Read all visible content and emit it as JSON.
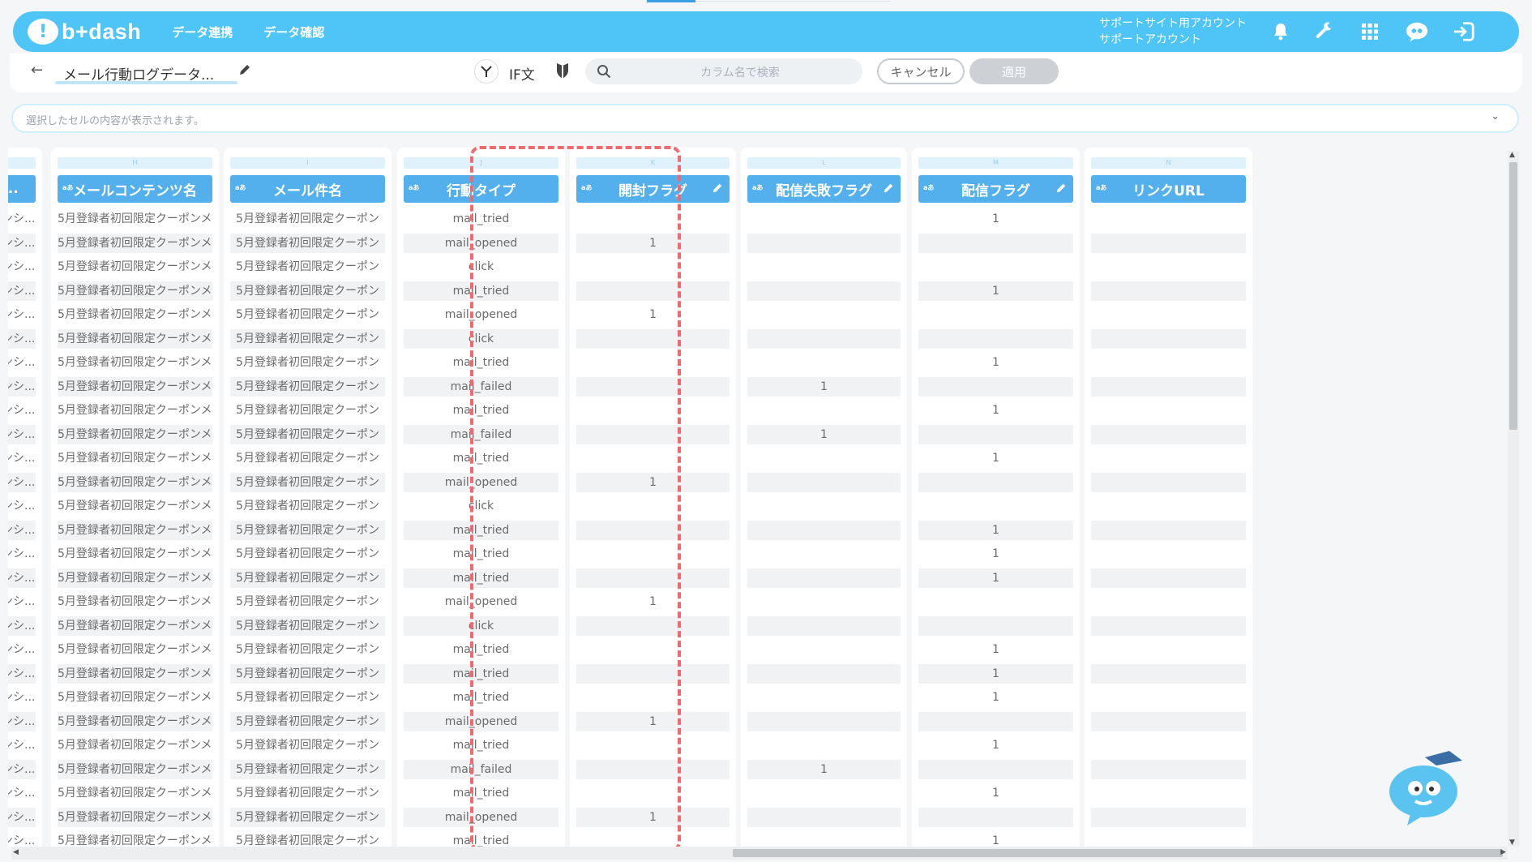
{
  "header": {
    "logo_text": "b+dash",
    "nav": [
      "データ連携",
      "データ確認"
    ],
    "account_line1": "サポートサイト用アカウント",
    "account_line2": "サポートアカウント",
    "bg_color": "#4ec4f7"
  },
  "toolbar": {
    "back_label": "←",
    "title": "メール行動ログデータ...",
    "if_label": "IF文",
    "search_placeholder": "カラム名で検索",
    "cancel_label": "キャンセル",
    "apply_label": "適用"
  },
  "cell_viewer": {
    "text": "選択したセルの内容が表示されます。"
  },
  "grid": {
    "columns": [
      {
        "letter": "",
        "name": "...",
        "type": "aあ"
      },
      {
        "letter": "H",
        "name": "メールコンテンツ名",
        "type": "aあ"
      },
      {
        "letter": "I",
        "name": "メール件名",
        "type": "aあ"
      },
      {
        "letter": "J",
        "name": "行動タイプ",
        "type": "aあ"
      },
      {
        "letter": "K",
        "name": "開封フラグ",
        "type": "aあ"
      },
      {
        "letter": "L",
        "name": "配信失敗フラグ",
        "type": "aあ"
      },
      {
        "letter": "M",
        "name": "配信フラグ",
        "type": "aあ"
      },
      {
        "letter": "N",
        "name": "リンクURL",
        "type": "aあ"
      }
    ],
    "partial_col_text": "ンシ...",
    "content_text": "5月登録者初回限定クーポンメ...",
    "subject_text": "5月登録者初回限定クーポン",
    "action_types": [
      "mail_tried",
      "mail_opened",
      "click",
      "mail_tried",
      "mail_opened",
      "click",
      "mail_tried",
      "mail_failed",
      "mail_tried",
      "mail_failed",
      "mail_tried",
      "mail_opened",
      "click",
      "mail_tried",
      "mail_tried",
      "mail_tried",
      "mail_opened",
      "click",
      "mail_tried",
      "mail_tried",
      "mail_tried",
      "mail_opened",
      "mail_tried",
      "mail_failed",
      "mail_tried",
      "mail_opened",
      "mail_tried"
    ],
    "open_flag": [
      "",
      "1",
      "",
      "",
      "1",
      "",
      "",
      "",
      "",
      "",
      "",
      "1",
      "",
      "",
      "",
      "",
      "1",
      "",
      "",
      "",
      "",
      "1",
      "",
      "",
      "",
      "1",
      ""
    ],
    "fail_flag": [
      "",
      "",
      "",
      "",
      "",
      "",
      "",
      "1",
      "",
      "1",
      "",
      "",
      "",
      "",
      "",
      "",
      "",
      "",
      "",
      "",
      "",
      "",
      "",
      "1",
      "",
      "",
      ""
    ],
    "send_flag": [
      "1",
      "",
      "",
      "1",
      "",
      "",
      "1",
      "",
      "1",
      "",
      "1",
      "",
      "",
      "1",
      "1",
      "1",
      "",
      "",
      "1",
      "1",
      "1",
      "",
      "1",
      "",
      "1",
      "",
      "1"
    ],
    "link_url": [
      "",
      "",
      "",
      "",
      "",
      "",
      "",
      "",
      "",
      "",
      "",
      "",
      "",
      "",
      "",
      "",
      "",
      "",
      "",
      "",
      "",
      "",
      "",
      "",
      "",
      "",
      ""
    ]
  },
  "colors": {
    "header_bg": "#4ec4f7",
    "column_head": "#54b0ec",
    "highlight": "#ef6a70"
  }
}
